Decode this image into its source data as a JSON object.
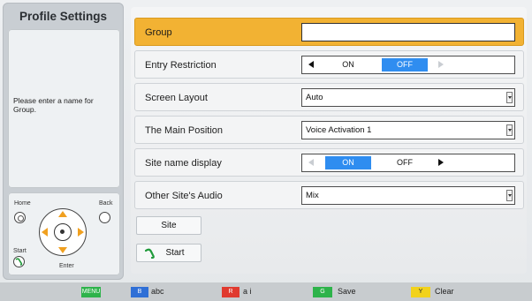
{
  "panel": {
    "title": "Profile Settings",
    "help_text": "Please enter a name for Group."
  },
  "remote": {
    "home_label": "Home",
    "back_label": "Back",
    "start_label": "Start",
    "enter_label": "Enter"
  },
  "settings": {
    "group": {
      "label": "Group",
      "value": ""
    },
    "entry_restriction": {
      "label": "Entry Restriction",
      "options": [
        "ON",
        "OFF"
      ],
      "selected": "OFF"
    },
    "screen_layout": {
      "label": "Screen Layout",
      "value": "Auto"
    },
    "main_position": {
      "label": "The Main Position",
      "value": "Voice Activation 1"
    },
    "site_name_display": {
      "label": "Site name display",
      "options": [
        "ON",
        "OFF"
      ],
      "selected": "ON"
    },
    "other_sites_audio": {
      "label": "Other Site's Audio",
      "value": "Mix"
    }
  },
  "buttons": {
    "site": "Site",
    "start": "Start"
  },
  "footer": {
    "keys": [
      {
        "key": "MENU",
        "color": "#2db34a",
        "label": ""
      },
      {
        "key": "B",
        "color": "#2f6fd6",
        "label": "abc"
      },
      {
        "key": "R",
        "color": "#e03a2f",
        "label": "a i"
      },
      {
        "key": "G",
        "color": "#2db34a",
        "label": "Save"
      },
      {
        "key": "Y",
        "color": "#f2d21c",
        "label": "Clear"
      }
    ]
  }
}
